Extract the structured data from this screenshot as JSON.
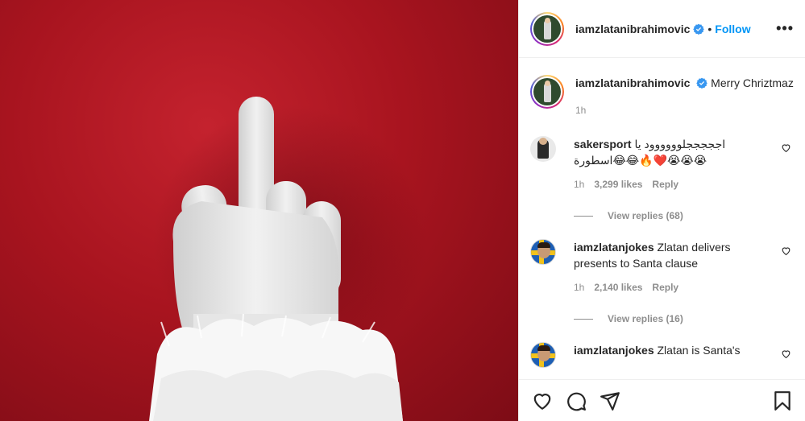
{
  "post": {
    "username": "iamzlatanibrahimovic",
    "dot": "•",
    "follow_label": "Follow",
    "more_label": "•••",
    "caption": {
      "username": "iamzlatanibrahimovic",
      "text": "Merry Chriztmaz",
      "time": "1h"
    },
    "comments": [
      {
        "username": "sakersport",
        "text": "اجججججلوووووود يا اسطورة😂😂🔥❤️😭😭😭",
        "time": "1h",
        "likes": "3,299 likes",
        "reply": "Reply",
        "view_replies": "View replies (68)"
      },
      {
        "username": "iamzlatanjokes",
        "text": "Zlatan delivers presents to Santa clause",
        "time": "1h",
        "likes": "2,140 likes",
        "reply": "Reply",
        "view_replies": "View replies (16)"
      },
      {
        "username": "iamzlatanjokes",
        "text": "Zlatan is Santa's"
      }
    ]
  },
  "colors": {
    "accent": "#0095f6",
    "muted": "#8e8e8e",
    "media_red": "#a8141f"
  },
  "icons": [
    "verified-badge-icon",
    "heart-icon",
    "comment-icon",
    "share-icon",
    "bookmark-icon",
    "more-icon"
  ]
}
